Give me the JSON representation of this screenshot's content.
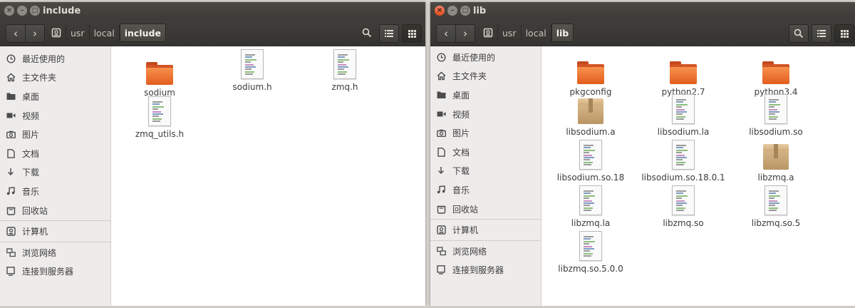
{
  "windows": {
    "include": {
      "title": "include",
      "path": [
        "usr",
        "local",
        "include"
      ],
      "files": [
        {
          "name": "sodium",
          "kind": "folder"
        },
        {
          "name": "sodium.h",
          "kind": "text"
        },
        {
          "name": "zmq.h",
          "kind": "text"
        },
        {
          "name": "zmq_utils.h",
          "kind": "text"
        }
      ]
    },
    "lib": {
      "title": "lib",
      "path": [
        "usr",
        "local",
        "lib"
      ],
      "files": [
        {
          "name": "pkgconfig",
          "kind": "folder"
        },
        {
          "name": "python2.7",
          "kind": "folder"
        },
        {
          "name": "python3.4",
          "kind": "folder"
        },
        {
          "name": "libsodium.a",
          "kind": "archive"
        },
        {
          "name": "libsodium.la",
          "kind": "text"
        },
        {
          "name": "libsodium.so",
          "kind": "text"
        },
        {
          "name": "libsodium.so.18",
          "kind": "text"
        },
        {
          "name": "libsodium.so.18.0.1",
          "kind": "text"
        },
        {
          "name": "libzmq.a",
          "kind": "archive"
        },
        {
          "name": "libzmq.la",
          "kind": "text"
        },
        {
          "name": "libzmq.so",
          "kind": "text"
        },
        {
          "name": "libzmq.so.5",
          "kind": "text"
        },
        {
          "name": "libzmq.so.5.0.0",
          "kind": "text"
        }
      ]
    }
  },
  "sidebar": {
    "places": [
      {
        "label": "最近使用的",
        "icon": "clock-icon"
      },
      {
        "label": "主文件夹",
        "icon": "home-icon"
      },
      {
        "label": "桌面",
        "icon": "desktop-folder-icon"
      },
      {
        "label": "视频",
        "icon": "video-icon"
      },
      {
        "label": "图片",
        "icon": "camera-icon"
      },
      {
        "label": "文档",
        "icon": "document-icon"
      },
      {
        "label": "下载",
        "icon": "download-icon"
      },
      {
        "label": "音乐",
        "icon": "music-icon"
      },
      {
        "label": "回收站",
        "icon": "trash-icon"
      }
    ],
    "devices": [
      {
        "label": "计算机",
        "icon": "drive-icon"
      }
    ],
    "network": [
      {
        "label": "浏览网络",
        "icon": "network-icon"
      },
      {
        "label": "连接到服务器",
        "icon": "server-icon"
      }
    ]
  },
  "colors": {
    "folder": "#e35d1e",
    "toolbar": "#3c3b37",
    "close_button": "#df4a16"
  }
}
